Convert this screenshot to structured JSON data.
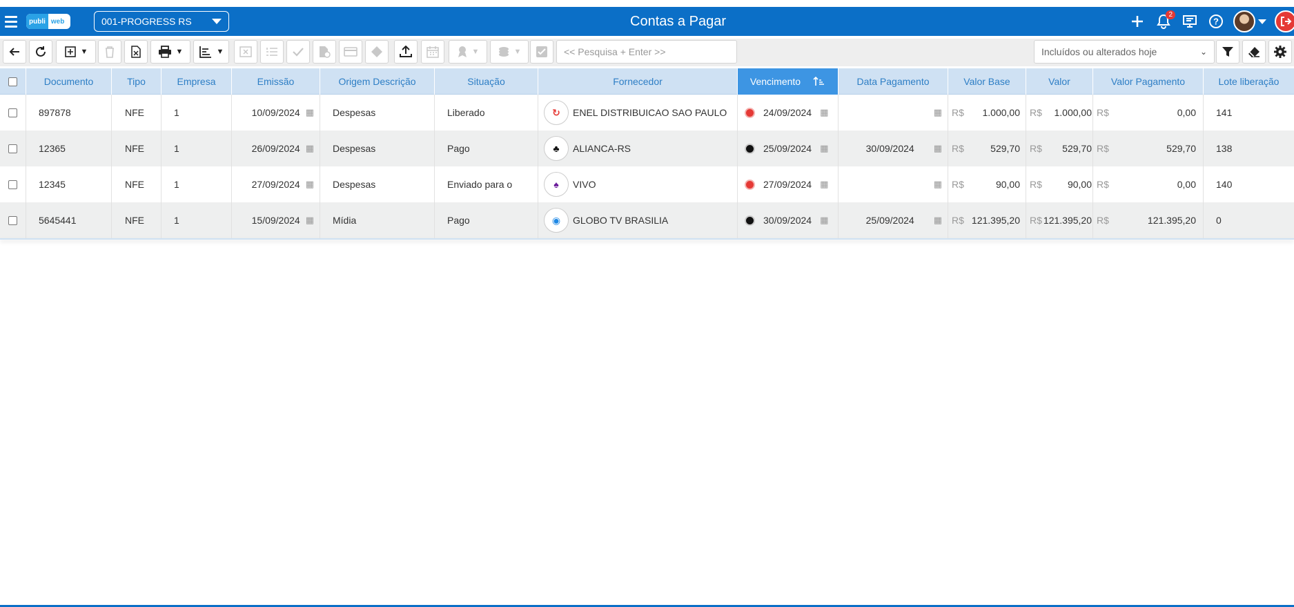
{
  "header": {
    "title": "Contas a Pagar",
    "logo_left": "publi",
    "logo_right": "web",
    "company": "001-PROGRESS RS",
    "notifications_count": "2"
  },
  "toolbar": {
    "search_placeholder": "<< Pesquisa + Enter >>",
    "filter_value": "Incluídos ou alterados hoje"
  },
  "table": {
    "columns": [
      "Documento",
      "Tipo",
      "Empresa",
      "Emissão",
      "Origem Descrição",
      "Situação",
      "Fornecedor",
      "Vencimento",
      "Data Pagamento",
      "Valor Base",
      "Valor",
      "Valor Pagamento",
      "Lote liberação"
    ],
    "currency": "R$",
    "rows": [
      {
        "documento": "897878",
        "tipo": "NFE",
        "empresa": "1",
        "emissao": "10/09/2024",
        "origem": "Despesas",
        "situacao": "Liberado",
        "fornecedor": "ENEL DISTRIBUICAO SAO PAULO",
        "status": "red",
        "vencimento": "24/09/2024",
        "data_pagamento": "",
        "valor_base": "1.000,00",
        "valor": "1.000,00",
        "valor_pagamento": "0,00",
        "lote": "141"
      },
      {
        "documento": "12365",
        "tipo": "NFE",
        "empresa": "1",
        "emissao": "26/09/2024",
        "origem": "Despesas",
        "situacao": "Pago",
        "fornecedor": "ALIANCA-RS",
        "status": "black",
        "vencimento": "25/09/2024",
        "data_pagamento": "30/09/2024",
        "valor_base": "529,70",
        "valor": "529,70",
        "valor_pagamento": "529,70",
        "lote": "138"
      },
      {
        "documento": "12345",
        "tipo": "NFE",
        "empresa": "1",
        "emissao": "27/09/2024",
        "origem": "Despesas",
        "situacao": "Enviado para o",
        "fornecedor": "VIVO",
        "status": "red",
        "vencimento": "27/09/2024",
        "data_pagamento": "",
        "valor_base": "90,00",
        "valor": "90,00",
        "valor_pagamento": "0,00",
        "lote": "140"
      },
      {
        "documento": "5645441",
        "tipo": "NFE",
        "empresa": "1",
        "emissao": "15/09/2024",
        "origem": "Mídia",
        "situacao": "Pago",
        "fornecedor": "GLOBO TV BRASILIA",
        "status": "black",
        "vencimento": "30/09/2024",
        "data_pagamento": "25/09/2024",
        "valor_base": "121.395,20",
        "valor": "121.395,20",
        "valor_pagamento": "121.395,20",
        "lote": "0"
      }
    ]
  }
}
